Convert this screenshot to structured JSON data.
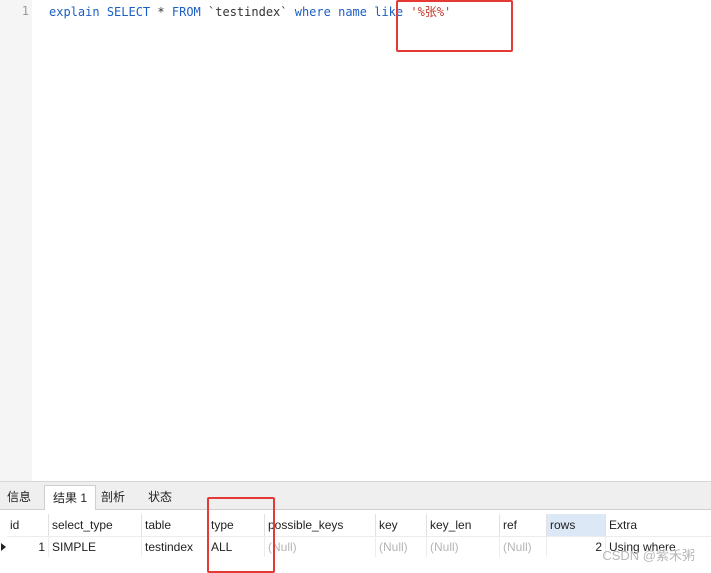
{
  "editor": {
    "line_number": "1",
    "code": {
      "kw_explain": "explain",
      "kw_select": "SELECT",
      "star": "*",
      "kw_from": "FROM",
      "table_ident": "`testindex`",
      "kw_where": "where",
      "col_name": "name",
      "kw_like": "like",
      "literal": "'%张%'"
    }
  },
  "tabs": [
    {
      "label": "信息",
      "active": false
    },
    {
      "label": "结果 1",
      "active": true
    },
    {
      "label": "剖析",
      "active": false
    },
    {
      "label": "状态",
      "active": false
    }
  ],
  "grid": {
    "columns": [
      "id",
      "select_type",
      "table",
      "type",
      "possible_keys",
      "key",
      "key_len",
      "ref",
      "rows",
      "Extra"
    ],
    "sorted_column": "rows",
    "rows": [
      [
        "1",
        "SIMPLE",
        "testindex",
        "ALL",
        "(Null)",
        "(Null)",
        "(Null)",
        "(Null)",
        "2",
        "Using where"
      ]
    ]
  },
  "watermark": "CSDN @紫禾粥",
  "colors": {
    "highlight": "#e53935",
    "keyword": "#1c5fc4",
    "string": "#c0392b"
  }
}
